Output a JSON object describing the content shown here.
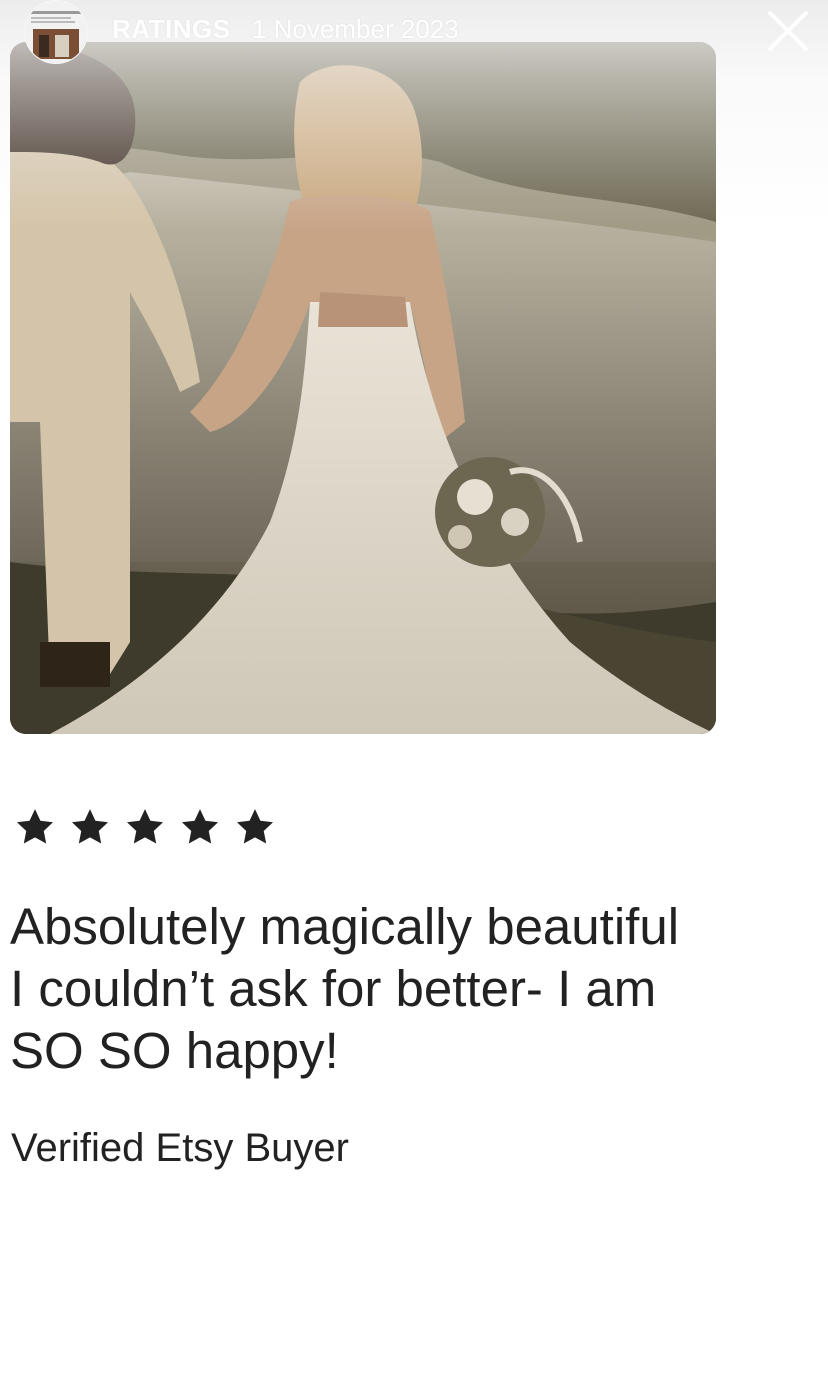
{
  "story": {
    "title": "RATINGS",
    "date": "1 November 2023",
    "close_icon": "close-icon",
    "avatar_icon": "avatar"
  },
  "review": {
    "rating": 5,
    "rating_max": 5,
    "star_color": "#222222",
    "text": "Absolutely magically beautiful\nI couldn’t ask for better- I am\nSO SO happy!",
    "reviewer": "Verified Etsy Buyer"
  },
  "photo": {
    "subject": "review-photo"
  }
}
